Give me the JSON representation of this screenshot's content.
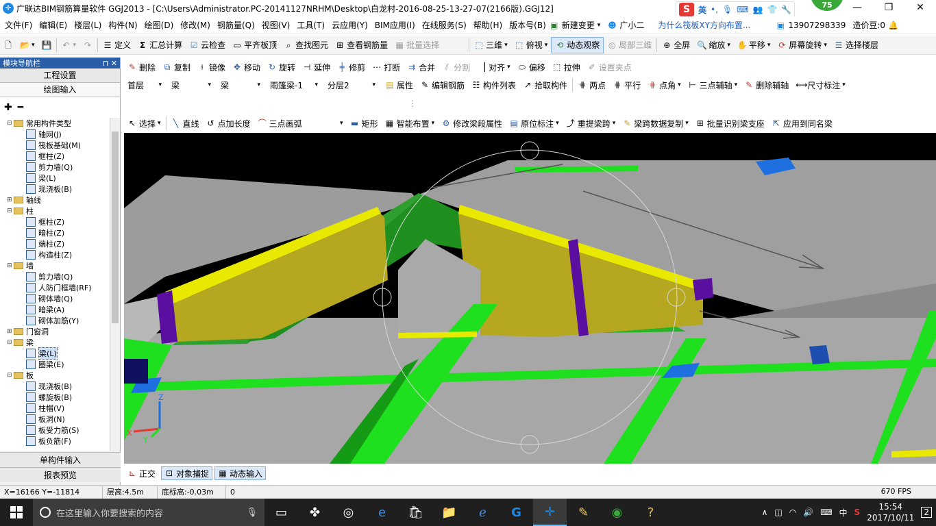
{
  "title": {
    "text": "广联达BIM钢筋算量软件 GGJ2013 - [C:\\Users\\Administrator.PC-20141127NRHM\\Desktop\\白龙村-2016-08-25-13-27-07(2166版).GGJ12]",
    "badge": "75",
    "ime_lang": "英"
  },
  "menu": {
    "items": [
      "文件(F)",
      "编辑(E)",
      "楼层(L)",
      "构件(N)",
      "绘图(D)",
      "修改(M)",
      "钢筋量(Q)",
      "视图(V)",
      "工具(T)",
      "云应用(Y)",
      "BIM应用(I)",
      "在线服务(S)",
      "帮助(H)",
      "版本号(B)"
    ],
    "new_change": "新建变更",
    "guangxiaoer": "广小二",
    "question": "为什么筏板XY方向布置...",
    "phone": "13907298339",
    "beans": "造价豆:0"
  },
  "toolbar1": {
    "define": "定义",
    "sum": "汇总计算",
    "cloud_check": "云检查",
    "align_top": "平齐板顶",
    "find": "查找图元",
    "view_rebar": "查看钢筋量",
    "batch_select": "批量选择",
    "three_d": "三维",
    "top_view": "俯视",
    "dynamic": "动态观察",
    "local_3d": "局部三维",
    "fullscreen": "全屏",
    "zoom": "缩放",
    "pan": "平移",
    "rotate_screen": "屏幕旋转",
    "select_floor": "选择楼层"
  },
  "toolbar2": {
    "delete": "删除",
    "copy": "复制",
    "mirror": "镜像",
    "move": "移动",
    "rotate": "旋转",
    "extend": "延伸",
    "trim": "修剪",
    "break": "打断",
    "merge": "合并",
    "split": "分割",
    "align": "对齐",
    "offset": "偏移",
    "stretch": "拉伸",
    "set_grip": "设置夹点"
  },
  "toolbar3": {
    "floor": "首层",
    "type1": "梁",
    "type2": "梁",
    "component": "雨篷梁-1",
    "layer": "分层2",
    "property": "属性",
    "edit_rebar": "编辑钢筋",
    "list": "构件列表",
    "pick": "拾取构件",
    "two_points": "两点",
    "parallel": "平行",
    "point_angle": "点角",
    "three_point_aux": "三点辅轴",
    "delete_aux": "删除辅轴",
    "dimension": "尺寸标注"
  },
  "toolbar4": {
    "select": "选择",
    "line": "直线",
    "point_length": "点加长度",
    "arc": "三点画弧",
    "rect": "矩形",
    "smart": "智能布置",
    "modify_span": "修改梁段属性",
    "in_situ": "原位标注",
    "re_extract": "重提梁跨",
    "span_copy": "梁跨数据复制",
    "batch_identify": "批量识别梁支座",
    "apply_same": "应用到同名梁"
  },
  "panel": {
    "header": "模块导航栏",
    "tab_engineering": "工程设置",
    "tab_drawing": "绘图输入",
    "bottom_single": "单构件输入",
    "bottom_report": "报表预览"
  },
  "tree": [
    {
      "level": 0,
      "kind": "folder",
      "toggle": "⊟",
      "label": "常用构件类型"
    },
    {
      "level": 1,
      "kind": "item",
      "icon": "axis-grid-icon",
      "label": "轴网(J)"
    },
    {
      "level": 1,
      "kind": "item",
      "icon": "raft-icon",
      "label": "筏板基础(M)"
    },
    {
      "level": 1,
      "kind": "item",
      "icon": "column-icon",
      "label": "框柱(Z)"
    },
    {
      "level": 1,
      "kind": "item",
      "icon": "shear-wall-icon",
      "label": "剪力墙(Q)"
    },
    {
      "level": 1,
      "kind": "item",
      "icon": "beam-icon",
      "label": "梁(L)"
    },
    {
      "level": 1,
      "kind": "item",
      "icon": "slab-icon",
      "label": "现浇板(B)"
    },
    {
      "level": 0,
      "kind": "folder",
      "toggle": "⊞",
      "label": "轴线"
    },
    {
      "level": 0,
      "kind": "folder",
      "toggle": "⊟",
      "label": "柱"
    },
    {
      "level": 1,
      "kind": "item",
      "icon": "column-icon",
      "label": "框柱(Z)"
    },
    {
      "level": 1,
      "kind": "item",
      "icon": "hidden-column-icon",
      "label": "暗柱(Z)"
    },
    {
      "level": 1,
      "kind": "item",
      "icon": "end-column-icon",
      "label": "端柱(Z)"
    },
    {
      "level": 1,
      "kind": "item",
      "icon": "constructional-column-icon",
      "label": "构造柱(Z)"
    },
    {
      "level": 0,
      "kind": "folder",
      "toggle": "⊟",
      "label": "墙"
    },
    {
      "level": 1,
      "kind": "item",
      "icon": "shear-wall-icon",
      "label": "剪力墙(Q)"
    },
    {
      "level": 1,
      "kind": "item",
      "icon": "civil-defense-door-icon",
      "label": "人防门框墙(RF)"
    },
    {
      "level": 1,
      "kind": "item",
      "icon": "masonry-wall-icon",
      "label": "砌体墙(Q)"
    },
    {
      "level": 1,
      "kind": "item",
      "icon": "hidden-beam-icon",
      "label": "暗梁(A)"
    },
    {
      "level": 1,
      "kind": "item",
      "icon": "masonry-rebar-icon",
      "label": "砌体加筋(Y)"
    },
    {
      "level": 0,
      "kind": "folder",
      "toggle": "⊞",
      "label": "门窗洞"
    },
    {
      "level": 0,
      "kind": "folder",
      "toggle": "⊟",
      "label": "梁"
    },
    {
      "level": 1,
      "kind": "item",
      "icon": "beam-icon",
      "label": "梁(L)",
      "selected": true
    },
    {
      "level": 1,
      "kind": "item",
      "icon": "ring-beam-icon",
      "label": "圈梁(E)"
    },
    {
      "level": 0,
      "kind": "folder",
      "toggle": "⊟",
      "label": "板"
    },
    {
      "level": 1,
      "kind": "item",
      "icon": "slab-icon",
      "label": "现浇板(B)"
    },
    {
      "level": 1,
      "kind": "item",
      "icon": "spiral-slab-icon",
      "label": "螺旋板(B)"
    },
    {
      "level": 1,
      "kind": "item",
      "icon": "column-cap-icon",
      "label": "柱帽(V)"
    },
    {
      "level": 1,
      "kind": "item",
      "icon": "slab-hole-icon",
      "label": "板洞(N)"
    },
    {
      "level": 1,
      "kind": "item",
      "icon": "slab-rebar-icon",
      "label": "板受力筋(S)"
    },
    {
      "level": 1,
      "kind": "item",
      "icon": "negative-rebar-icon",
      "label": "板负筋(F)"
    }
  ],
  "status_tabs": {
    "ortho": "正交",
    "snap": "对象捕捉",
    "dynamic_input": "动态输入"
  },
  "status": {
    "coords": "X=16166 Y=-11814",
    "floor_height": "层高:4.5m",
    "bottom_elev": "底标高:-0.03m",
    "value": "0",
    "fps": "670 FPS"
  },
  "taskbar": {
    "search": "在这里输入你要搜索的内容",
    "time": "15:54",
    "date": "2017/10/11",
    "ime": "中",
    "notifications": "2"
  },
  "colors": {
    "beam_green": "#1ee01e",
    "top_yellow": "#e8e800",
    "slab_gray": "#9c9c9c",
    "column_purple": "#5a0fa0",
    "support_blue": "#1e6fe0",
    "viewport_bg": "#000000"
  }
}
